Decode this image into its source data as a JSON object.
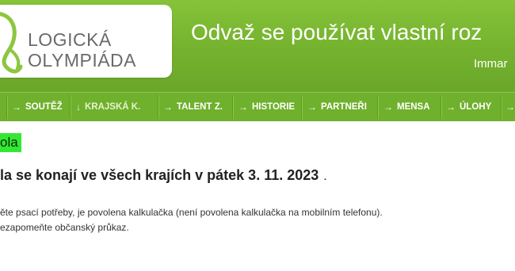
{
  "header": {
    "logo": {
      "line1": "LOGICKÁ",
      "line2": "OLYMPIÁDA"
    },
    "slogan": "Odvaž se používat vlastní roz",
    "subslogan": "Immar"
  },
  "nav": {
    "items": [
      {
        "label": "SOUTĚŽ",
        "arrow": "→",
        "active": false
      },
      {
        "label": "KRAJSKÁ K.",
        "arrow": "↓",
        "active": true
      },
      {
        "label": "TALENT Z.",
        "arrow": "→",
        "active": false
      },
      {
        "label": "HISTORIE",
        "arrow": "→",
        "active": false
      },
      {
        "label": "PARTNEŘI",
        "arrow": "→",
        "active": false
      },
      {
        "label": "MENSA",
        "arrow": "→",
        "active": false
      },
      {
        "label": "ÚLOHY",
        "arrow": "→",
        "active": false
      },
      {
        "label": "",
        "arrow": "→",
        "active": false
      }
    ]
  },
  "content": {
    "badge": "ola",
    "headline": "la se konají ve všech krajích v pátek 3. 11. 2023",
    "headline_tail": ".",
    "paragraph1": "ěte psací potřeby, je povolena kalkulačka (není povolena kalkulačka na mobilním telefonu).",
    "paragraph2": "ezapomeňte občanský průkaz."
  },
  "colors": {
    "brand_green": "#6fb02c",
    "badge_green": "#33e833",
    "logo_green": "#8cc63f"
  }
}
